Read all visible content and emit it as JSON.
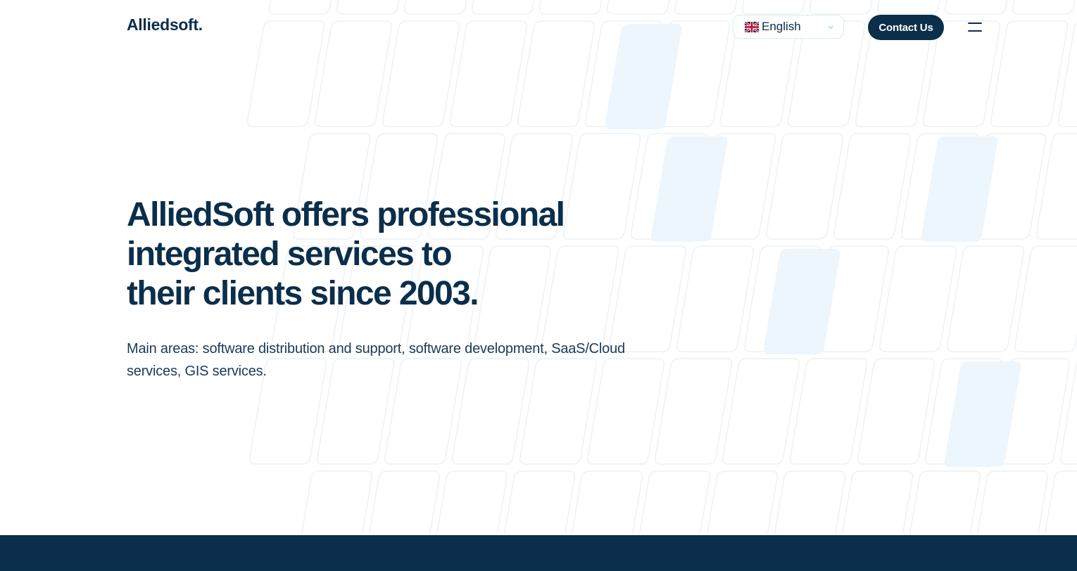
{
  "header": {
    "logo": "Alliedsoft.",
    "language": {
      "selected": "English",
      "flag_icon": "uk-flag-icon"
    },
    "contact_label": "Contact Us",
    "menu_icon": "hamburger-menu-icon"
  },
  "hero": {
    "title_lines": [
      "AlliedSoft offers professional",
      "integrated services to",
      "their clients since 2003."
    ],
    "subtitle_lines": [
      "Main areas: software distribution and support, software development, SaaS/Cloud",
      "services, GIS services."
    ]
  },
  "colors": {
    "brand_dark": "#0b2e4a",
    "tile_highlight": "#eef6fd",
    "tile_outline": "#f3f5f7"
  }
}
